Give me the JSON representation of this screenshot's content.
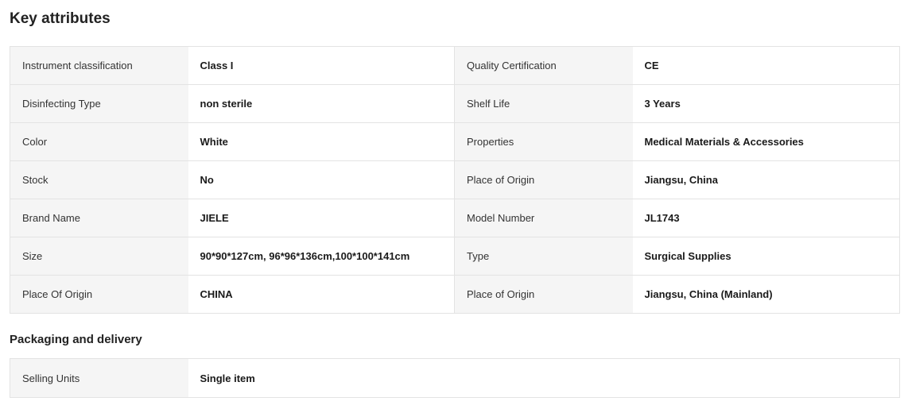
{
  "key_attributes": {
    "title": "Key attributes",
    "rows": [
      {
        "l1": "Instrument classification",
        "v1": "Class I",
        "l2": "Quality Certification",
        "v2": "CE"
      },
      {
        "l1": "Disinfecting Type",
        "v1": "non sterile",
        "l2": "Shelf Life",
        "v2": "3 Years"
      },
      {
        "l1": "Color",
        "v1": "White",
        "l2": "Properties",
        "v2": "Medical Materials & Accessories"
      },
      {
        "l1": "Stock",
        "v1": "No",
        "l2": "Place of Origin",
        "v2": "Jiangsu, China"
      },
      {
        "l1": "Brand Name",
        "v1": "JIELE",
        "l2": "Model Number",
        "v2": "JL1743"
      },
      {
        "l1": "Size",
        "v1": "90*90*127cm, 96*96*136cm,100*100*141cm",
        "l2": "Type",
        "v2": "Surgical Supplies"
      },
      {
        "l1": "Place Of Origin",
        "v1": "CHINA",
        "l2": "Place of Origin",
        "v2": "Jiangsu, China (Mainland)"
      }
    ]
  },
  "packaging": {
    "title": "Packaging and delivery",
    "rows": [
      {
        "label": "Selling Units",
        "value": "Single item"
      }
    ]
  }
}
